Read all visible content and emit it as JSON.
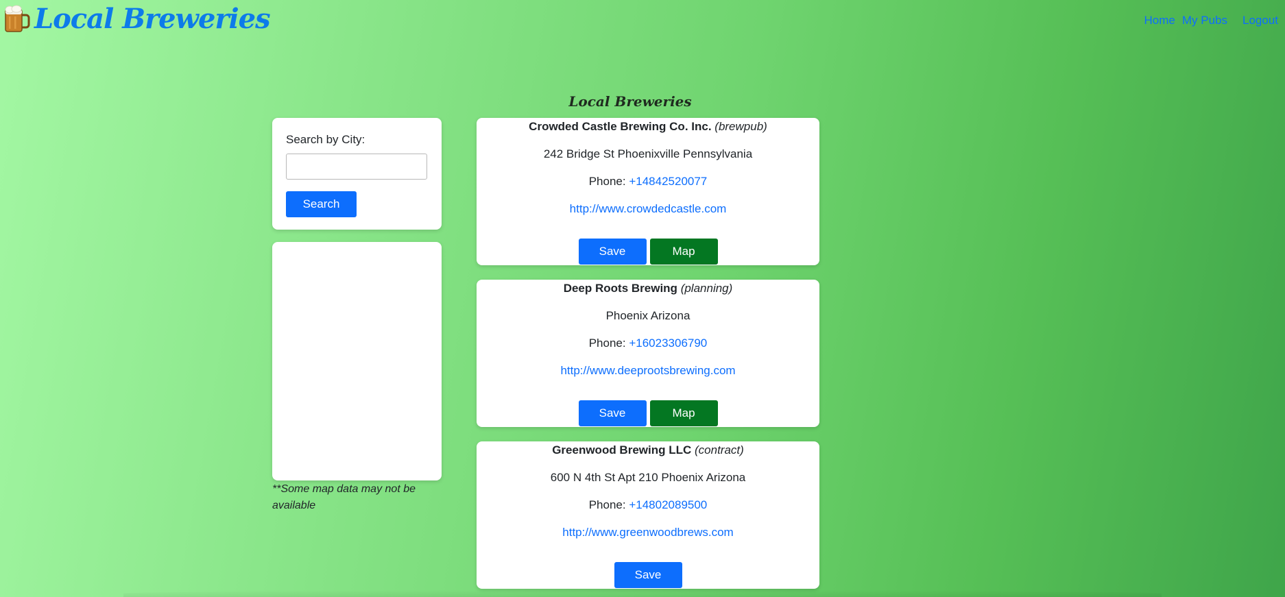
{
  "header": {
    "brand_title": "Local Breweries",
    "nav": [
      {
        "label": "Home"
      },
      {
        "label": "My Pubs"
      },
      {
        "label": "Logout"
      }
    ]
  },
  "page_heading": "Local Breweries",
  "search": {
    "label": "Search by City:",
    "value": "",
    "placeholder": "",
    "button_label": "Search"
  },
  "map": {
    "note": "**Some map data may not be available"
  },
  "breweries": [
    {
      "name": "Crowded Castle Brewing Co. Inc.",
      "type": "(brewpub)",
      "address": "242 Bridge St Phoenixville Pennsylvania",
      "phone_label": "Phone: ",
      "phone": "+14842520077",
      "website": "http://www.crowdedcastle.com",
      "save_label": "Save",
      "map_label": "Map"
    },
    {
      "name": "Deep Roots Brewing",
      "type": "(planning)",
      "address": "Phoenix Arizona",
      "phone_label": "Phone: ",
      "phone": "+16023306790",
      "website": "http://www.deeprootsbrewing.com",
      "save_label": "Save",
      "map_label": "Map"
    },
    {
      "name": "Greenwood Brewing LLC",
      "type": "(contract)",
      "address": "600 N 4th St Apt 210 Phoenix Arizona",
      "phone_label": "Phone: ",
      "phone": "+14802089500",
      "website": "http://www.greenwoodbrews.com",
      "save_label": "Save"
    }
  ],
  "colors": {
    "accent_blue": "#0d6efd",
    "map_green": "#047722",
    "brand_blue": "#0d7bea"
  },
  "icons": {
    "brand": "beer-mug-icon"
  }
}
